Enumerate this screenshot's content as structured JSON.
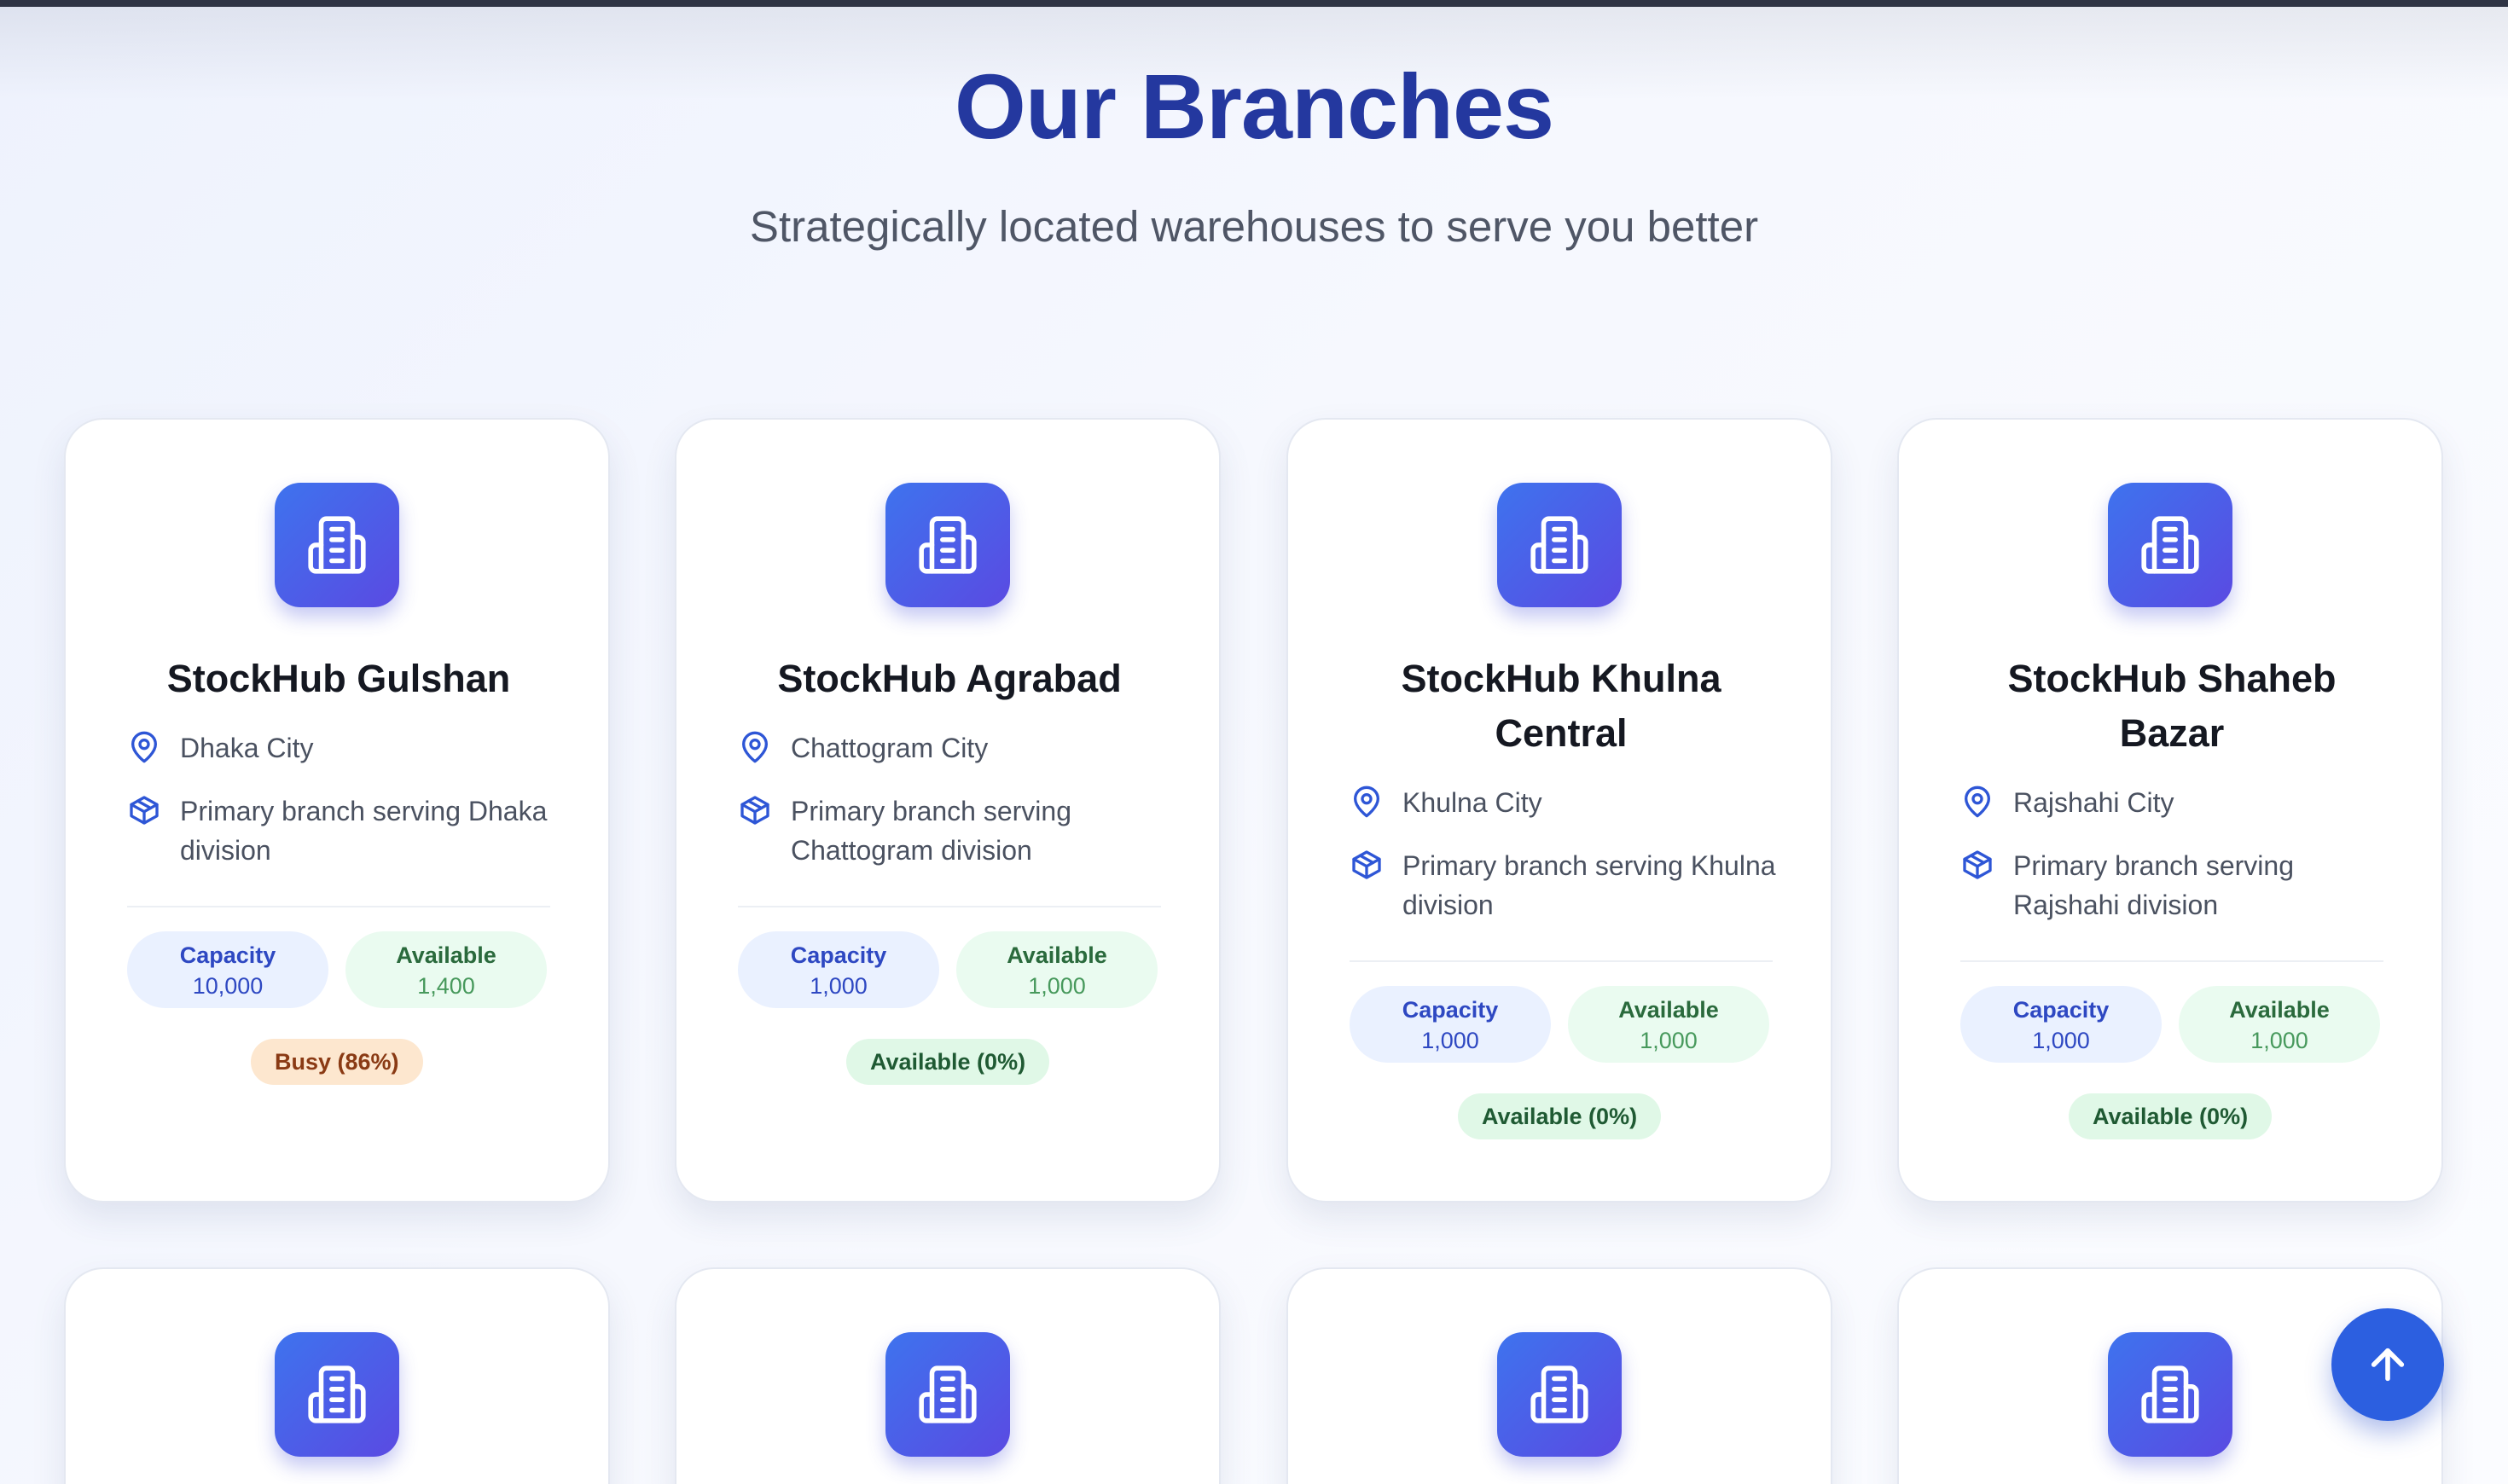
{
  "header": {
    "title": "Our Branches",
    "subtitle": "Strategically located warehouses to serve you better"
  },
  "branches": [
    {
      "name": "StockHub Gulshan",
      "location": "Dhaka City",
      "description": "Primary branch serving Dhaka division",
      "capacity_label": "Capacity",
      "capacity_value": "10,000",
      "available_label": "Available",
      "available_value": "1,400",
      "status": "Busy (86%)",
      "status_type": "busy"
    },
    {
      "name": "StockHub Agrabad",
      "location": "Chattogram City",
      "description": "Primary branch serving Chattogram division",
      "capacity_label": "Capacity",
      "capacity_value": "1,000",
      "available_label": "Available",
      "available_value": "1,000",
      "status": "Available (0%)",
      "status_type": "available"
    },
    {
      "name": "StockHub Khulna Central",
      "location": "Khulna City",
      "description": "Primary branch serving Khulna division",
      "capacity_label": "Capacity",
      "capacity_value": "1,000",
      "available_label": "Available",
      "available_value": "1,000",
      "status": "Available (0%)",
      "status_type": "available"
    },
    {
      "name": "StockHub Shaheb Bazar",
      "location": "Rajshahi City",
      "description": "Primary branch serving Rajshahi division",
      "capacity_label": "Capacity",
      "capacity_value": "1,000",
      "available_label": "Available",
      "available_value": "1,000",
      "status": "Available (0%)",
      "status_type": "available"
    }
  ],
  "colors": {
    "title": "#24389f",
    "icon_gradient_start": "#3e73ee",
    "icon_gradient_end": "#5a4ae2",
    "busy_badge": "#fde7cf",
    "available_badge": "#e0f8e7"
  },
  "icons": {
    "branch": "building-icon",
    "location": "map-pin-icon",
    "description": "package-icon",
    "scroll_top": "arrow-up-icon"
  }
}
